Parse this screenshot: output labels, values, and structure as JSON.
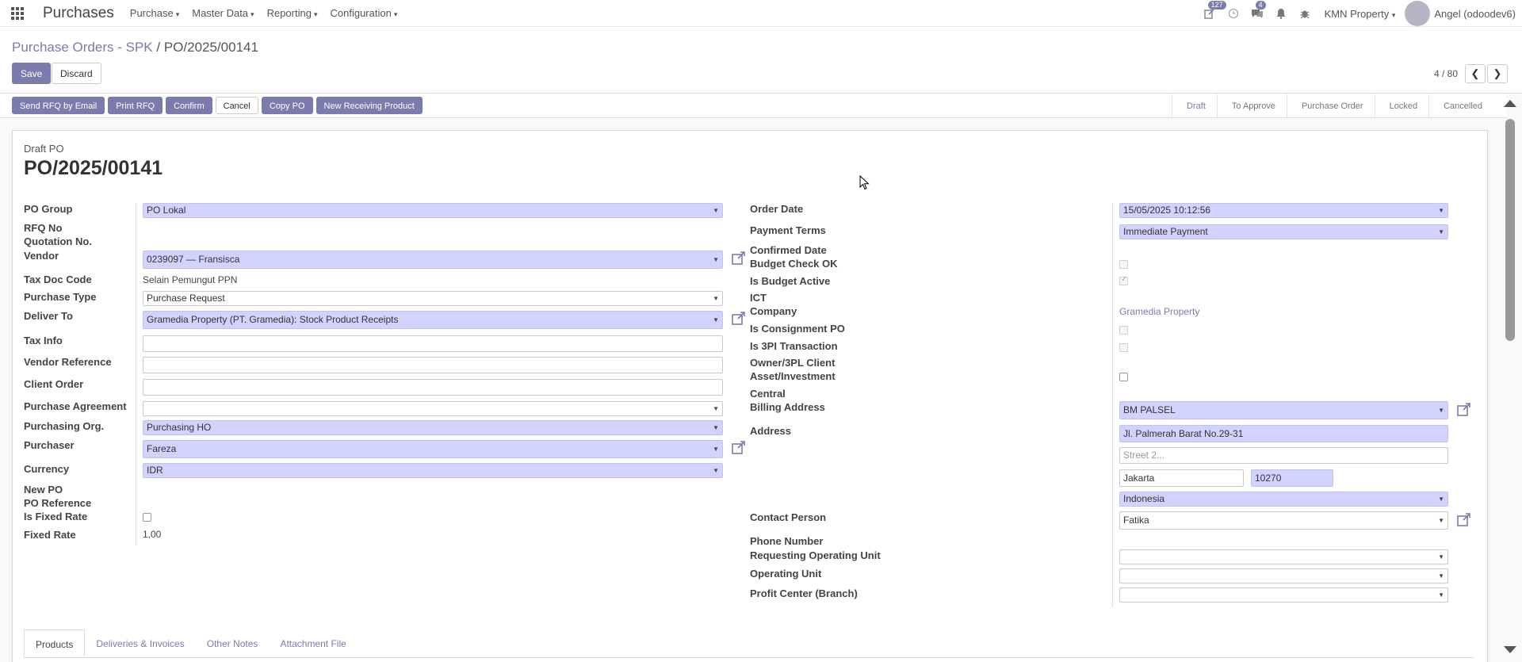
{
  "navbar": {
    "app_title": "Purchases",
    "menus": [
      "Purchase",
      "Master Data",
      "Reporting",
      "Configuration"
    ],
    "activity_count": "127",
    "messages_count": "4",
    "company": "KMN Property",
    "user": "Angel (odoodev6)"
  },
  "breadcrumb": {
    "parent": "Purchase Orders - SPK",
    "separator": "/",
    "current": "PO/2025/00141"
  },
  "actions": {
    "save": "Save",
    "discard": "Discard"
  },
  "pager": {
    "value": "4 / 80"
  },
  "status_buttons": [
    "Send RFQ by Email",
    "Print RFQ",
    "Confirm",
    "Cancel",
    "Copy PO",
    "New Receiving Product"
  ],
  "stages": [
    "Draft",
    "To Approve",
    "Purchase Order",
    "Locked",
    "Cancelled"
  ],
  "document": {
    "state_label": "Draft PO",
    "name": "PO/2025/00141"
  },
  "left": {
    "po_group_label": "PO Group",
    "po_group": "PO Lokal",
    "rfq_no_label": "RFQ No",
    "quotation_no_label": "Quotation No.",
    "vendor_label": "Vendor",
    "vendor": "0239097 — Fransisca",
    "tax_doc_code_label": "Tax Doc Code",
    "tax_doc_code": "Selain Pemungut PPN",
    "purchase_type_label": "Purchase Type",
    "purchase_type": "Purchase Request",
    "deliver_to_label": "Deliver To",
    "deliver_to": "Gramedia Property (PT. Gramedia): Stock Product Receipts",
    "tax_info_label": "Tax Info",
    "vendor_reference_label": "Vendor Reference",
    "client_order_label": "Client Order",
    "purchase_agreement_label": "Purchase Agreement",
    "purchasing_org_label": "Purchasing Org.",
    "purchasing_org": "Purchasing HO",
    "purchaser_label": "Purchaser",
    "purchaser": "Fareza",
    "currency_label": "Currency",
    "currency": "IDR",
    "new_po_label": "New PO",
    "po_reference_label": "PO Reference",
    "is_fixed_rate_label": "Is Fixed Rate",
    "fixed_rate_label": "Fixed Rate",
    "fixed_rate": "1,00"
  },
  "right": {
    "order_date_label": "Order Date",
    "order_date": "15/05/2025 10:12:56",
    "payment_terms_label": "Payment Terms",
    "payment_terms": "Immediate Payment",
    "confirmed_date_label": "Confirmed Date",
    "budget_check_label": "Budget Check OK",
    "is_budget_active_label": "Is Budget Active",
    "ict_label": "ICT",
    "company_label": "Company",
    "company": "Gramedia Property",
    "is_consignment_label": "Is Consignment PO",
    "is_3pl_label": "Is 3PI Transaction",
    "owner_3pl_label": "Owner/3PL Client",
    "asset_investment_label": "Asset/Investment",
    "central_label": "Central",
    "billing_address_label": "Billing Address",
    "billing_address": "BM PALSEL",
    "address_label": "Address",
    "street": "Jl. Palmerah Barat No.29-31",
    "street2_placeholder": "Street 2...",
    "city": "Jakarta",
    "zip": "10270",
    "country": "Indonesia",
    "contact_person_label": "Contact Person",
    "contact_person": "Fatika",
    "phone_label": "Phone Number",
    "requesting_ou_label": "Requesting Operating Unit",
    "operating_unit_label": "Operating Unit",
    "profit_center_label": "Profit Center (Branch)"
  },
  "tabs": [
    "Products",
    "Deliveries & Invoices",
    "Other Notes",
    "Attachment File"
  ],
  "colors": {
    "accent": "#7c7bad",
    "required_field": "#d2d2ff"
  }
}
